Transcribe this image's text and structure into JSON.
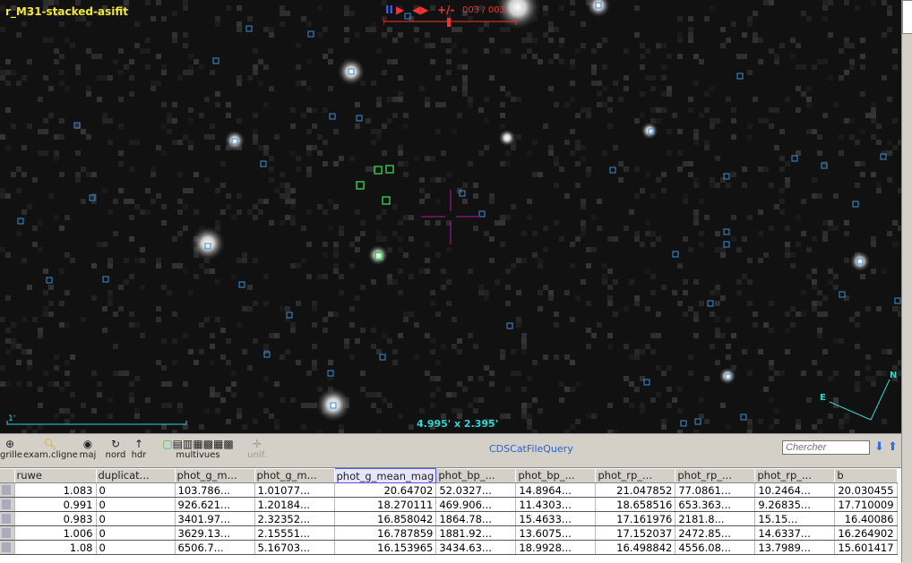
{
  "image": {
    "title": "r_M31-stacked-asifit",
    "fov": "4.995' x 2.395'",
    "scale_label": "1'",
    "frame_counter": "003 / 003",
    "frame_controls": [
      "II",
      "▶",
      "◀▶",
      "+/-"
    ],
    "compass": {
      "north": "N",
      "east": "E"
    },
    "colors": {
      "title": "#f2e83a",
      "overlay": "#34d4d4",
      "catalog_marker": "#3a8fd6",
      "selected_marker": "#2fc24a",
      "reticle": "#b01a96"
    }
  },
  "toolbar": {
    "tools": [
      {
        "label": "grille",
        "icon": "globe-icon"
      },
      {
        "label": "exam.cligne",
        "icon": "magnifier-icon"
      },
      {
        "label": "maj",
        "icon": "eye-icon"
      },
      {
        "label": "nord",
        "icon": "refresh-icon"
      },
      {
        "label": "hdr",
        "icon": "north-arrow-icon"
      },
      {
        "label": "multivues",
        "icon": "histogram-icon"
      },
      {
        "label": "unif.",
        "icon": "crosshair-icon"
      }
    ],
    "hdr_label": "hdr",
    "catalog_name": "CDSCatFileQuery",
    "search_placeholder": "Chercher"
  },
  "table": {
    "columns": [
      "",
      "ruwe",
      "duplicat...",
      "phot_g_m...",
      "phot_g_m...",
      "phot_g_mean_mag",
      "phot_bp_...",
      "phot_bp_...",
      "phot_rp_...",
      "phot_rp_...",
      "phot_rp_...",
      "b"
    ],
    "rows": [
      [
        "",
        "1.083",
        "0",
        "103.786...",
        "1.01077...",
        "20.64702",
        "52.0327...",
        "14.8964...",
        "21.047852",
        "77.0861...",
        "10.2464...",
        "20.030455"
      ],
      [
        "",
        "0.991",
        "0",
        "926.621...",
        "1.20184...",
        "18.270111",
        "469.906...",
        "11.4303...",
        "18.658516",
        "653.363...",
        "9.26835...",
        "17.710009"
      ],
      [
        "",
        "0.983",
        "0",
        "3401.97...",
        "2.32352...",
        "16.858042",
        "1864.78...",
        "15.4633...",
        "17.161976",
        "2181.8...",
        "15.15...",
        "16.40086"
      ],
      [
        "",
        "1.006",
        "0",
        "3629.13...",
        "2.15551...",
        "16.787859",
        "1881.92...",
        "13.6075...",
        "17.152037",
        "2472.85...",
        "14.6337...",
        "16.264902"
      ],
      [
        "",
        "1.08",
        "0",
        "6506.7...",
        "5.16703...",
        "16.153965",
        "3434.63...",
        "18.9928...",
        "16.498842",
        "4556.08...",
        "13.7989...",
        "15.601417"
      ]
    ]
  }
}
